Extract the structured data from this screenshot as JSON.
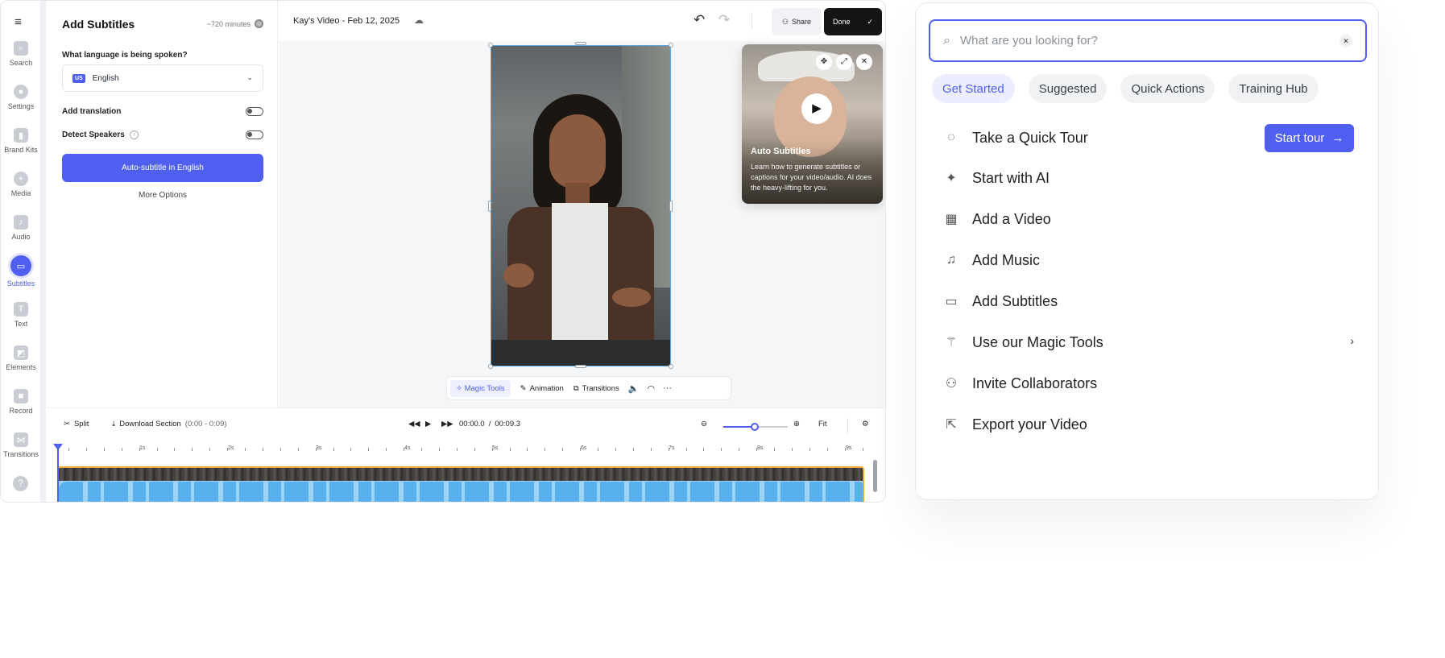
{
  "rail": {
    "items": [
      {
        "label": "Search",
        "icon": "search-icon"
      },
      {
        "label": "Settings",
        "icon": "gear-icon"
      },
      {
        "label": "Brand Kits",
        "icon": "brand-kit-icon"
      },
      {
        "label": "Media",
        "icon": "plus-icon"
      },
      {
        "label": "Audio",
        "icon": "music-note-icon"
      },
      {
        "label": "Subtitles",
        "icon": "subtitles-icon"
      },
      {
        "label": "Text",
        "icon": "text-icon"
      },
      {
        "label": "Elements",
        "icon": "elements-icon"
      },
      {
        "label": "Record",
        "icon": "record-icon"
      },
      {
        "label": "Transitions",
        "icon": "transitions-icon"
      }
    ],
    "help": "?"
  },
  "panel": {
    "title": "Add Subtitles",
    "minutes": "~720 minutes",
    "question": "What language is being spoken?",
    "lang_flag": "US",
    "lang_value": "English",
    "add_translation": "Add translation",
    "detect_speakers": "Detect Speakers",
    "cta": "Auto-subtitle in English",
    "more": "More Options"
  },
  "topbar": {
    "title": "Kay's Video - Feb 12, 2025",
    "share": "Share",
    "done": "Done"
  },
  "tutorial": {
    "title": "Auto Subtitles",
    "desc": "Learn how to generate subtitles or captions for your video/audio. AI does the heavy-lifting for you."
  },
  "tools": {
    "magic": "Magic Tools",
    "animation": "Animation",
    "transitions": "Transitions"
  },
  "timeline": {
    "split": "Split",
    "download": "Download Section",
    "range": "(0:00 - 0:09)",
    "current": "00:00.0",
    "slash": "/",
    "total": "00:09.3",
    "fit": "Fit",
    "ticks": [
      "1s",
      "2s",
      "3s",
      "4s",
      "5s",
      "6s",
      "7s",
      "8s",
      "9s"
    ]
  },
  "quickmenu": {
    "placeholder": "What are you looking for?",
    "tabs": [
      "Get Started",
      "Suggested",
      "Quick Actions",
      "Training Hub"
    ],
    "items": [
      {
        "label": "Take a Quick Tour",
        "icon": "chat-bubble-icon"
      },
      {
        "label": "Start with AI",
        "icon": "sparkle-icon"
      },
      {
        "label": "Add a Video",
        "icon": "film-icon"
      },
      {
        "label": "Add Music",
        "icon": "music-icon"
      },
      {
        "label": "Add Subtitles",
        "icon": "subtitles-icon"
      },
      {
        "label": "Use our Magic Tools",
        "icon": "magic-wand-icon"
      },
      {
        "label": "Invite Collaborators",
        "icon": "users-icon"
      },
      {
        "label": "Export your Video",
        "icon": "export-icon"
      }
    ],
    "start_tour": "Start tour"
  },
  "colors": {
    "accent": "#4f5ff0",
    "track_border": "#f1a638",
    "waveform": "#59b0ef"
  }
}
